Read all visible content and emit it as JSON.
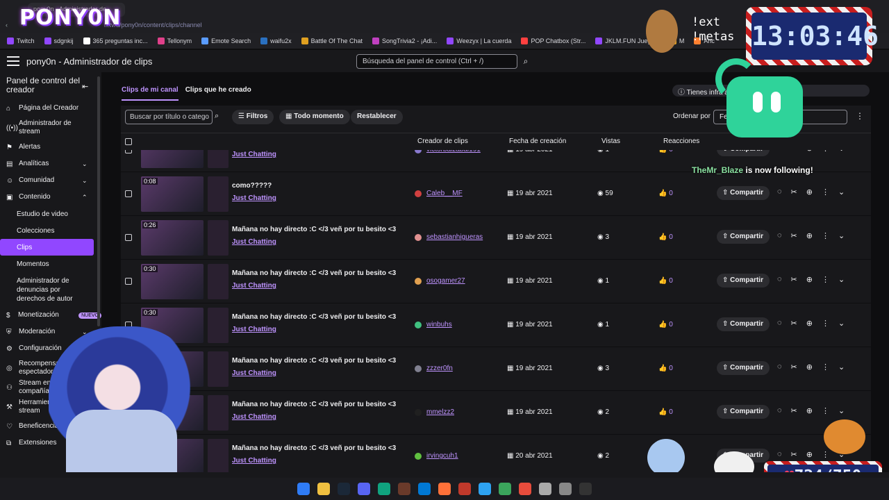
{
  "browser": {
    "tab_title": "pony0n - Administrador de",
    "url": "h.tv/u/pony0n/content/clips/channel"
  },
  "bookmarks": [
    {
      "label": "Twitch",
      "color": "#9147ff"
    },
    {
      "label": "sdgnkij",
      "color": "#9147ff"
    },
    {
      "label": "365 preguntas inc...",
      "color": "#ffffff"
    },
    {
      "label": "Tellonym",
      "color": "#e0408a"
    },
    {
      "label": "Emote Search",
      "color": "#5a9cff"
    },
    {
      "label": "waifu2x",
      "color": "#2a70c0"
    },
    {
      "label": "Battle Of The Chat",
      "color": "#e0a020"
    },
    {
      "label": "SongTrivia2 - ¡Adi...",
      "color": "#c040c0"
    },
    {
      "label": "Weezyx | La cuerda",
      "color": "#9147ff"
    },
    {
      "label": "POP Chatbox (Str...",
      "color": "#ff4040"
    },
    {
      "label": "JKLM.FUN Juego...",
      "color": "#9147ff"
    },
    {
      "label": "M",
      "color": "#e0a020"
    },
    {
      "label": "Anc",
      "color": "#ff8030"
    }
  ],
  "overlay": {
    "logo": "PONY0N",
    "clock": "13:03:46",
    "commands": [
      "!ext",
      "!metas"
    ],
    "follow_name": "TheMr_Blaze",
    "follow_text": " is now following!",
    "goal": "724/750"
  },
  "topbar": {
    "title": "pony0n - Administrador de clips",
    "search_placeholder": "Búsqueda del panel de control (Ctrl + /)"
  },
  "sidebar": {
    "header": "Panel de control del creador",
    "items": [
      {
        "label": "Página del Creador",
        "icon": "⌂"
      },
      {
        "label": "Administrador de stream",
        "icon": "((•))"
      },
      {
        "label": "Alertas",
        "icon": "⚑"
      },
      {
        "label": "Analíticas",
        "icon": "▤",
        "chevron": "⌄"
      },
      {
        "label": "Comunidad",
        "icon": "☺",
        "chevron": "⌄"
      },
      {
        "label": "Contenido",
        "icon": "▣",
        "chevron": "⌃"
      }
    ],
    "sub_items": [
      "Estudio de video",
      "Colecciones",
      "Clips",
      "Momentos",
      "Administrador de denuncias por derechos de autor"
    ],
    "items_after": [
      {
        "label": "Monetización",
        "icon": "$",
        "badge": "NUEVO"
      },
      {
        "label": "Moderación",
        "icon": "⛨",
        "chevron": "⌄"
      },
      {
        "label": "Configuración",
        "icon": "⚙"
      },
      {
        "label": "Recompensas del espectador",
        "icon": "◎"
      },
      {
        "label": "Stream en compañía",
        "icon": "⚇"
      },
      {
        "label": "Herramientas de stream",
        "icon": "⚒"
      },
      {
        "label": "Beneficencia",
        "icon": "♡"
      },
      {
        "label": "Extensiones",
        "icon": "⧉"
      }
    ]
  },
  "tabs": [
    "Clips de mi canal",
    "Clips que he creado"
  ],
  "info_pill": "Tienes infra                                autor en tu canal",
  "toolbar": {
    "filter_placeholder": "Buscar por título o catego",
    "filters": "Filtros",
    "time": "Todo momento",
    "reset": "Restablecer",
    "sort_label": "Ordenar por",
    "sort_value": "Fec                    s primero)"
  },
  "columns": {
    "creator": "Creador de clips",
    "date": "Fecha de creación",
    "views": "Vistas",
    "reactions": "Reacciones"
  },
  "rows": [
    {
      "duration": "",
      "title": "",
      "game": "Just Chatting",
      "creator": "victorbalzabal191",
      "date": "19 abr 2021",
      "views": "1",
      "reactions": "0",
      "share": "Compartir",
      "avatar_color": "#8a7ad0"
    },
    {
      "duration": "0:08",
      "title": "como?????",
      "game": "Just Chatting",
      "creator": "Caleb__MF",
      "date": "19 abr 2021",
      "views": "59",
      "reactions": "0",
      "share": "Compartir",
      "avatar_color": "#d04040"
    },
    {
      "duration": "0:26",
      "title": "Mañana no hay directo :C </3 veñ por tu besito <3",
      "game": "Just Chatting",
      "creator": "sebastianhigueras",
      "date": "19 abr 2021",
      "views": "3",
      "reactions": "0",
      "share": "Compartir",
      "avatar_color": "#e09090"
    },
    {
      "duration": "0:30",
      "title": "Mañana no hay directo :C </3 veñ por tu besito <3",
      "game": "Just Chatting",
      "creator": "osogamer27",
      "date": "19 abr 2021",
      "views": "1",
      "reactions": "0",
      "share": "Compartir",
      "avatar_color": "#e0a050"
    },
    {
      "duration": "0:30",
      "title": "Mañana no hay directo :C </3 veñ por tu besito <3",
      "game": "Just Chatting",
      "creator": "winbuhs",
      "date": "19 abr 2021",
      "views": "1",
      "reactions": "0",
      "share": "Compartir",
      "avatar_color": "#40c080"
    },
    {
      "duration": "0:30",
      "title": "Mañana no hay directo :C </3 veñ por tu besito <3",
      "game": "Just Chatting",
      "creator": "zzzer0fn",
      "date": "19 abr 2021",
      "views": "3",
      "reactions": "0",
      "share": "Compartir",
      "avatar_color": "#808090"
    },
    {
      "duration": "",
      "title": "Mañana no hay directo :C </3 veñ por tu besito <3",
      "game": "Just Chatting",
      "creator": "mmelzz2",
      "date": "19 abr 2021",
      "views": "2",
      "reactions": "0",
      "share": "Compartir",
      "avatar_color": "#202020"
    },
    {
      "duration": "0:",
      "title": "Mañana no hay directo :C </3 veñ por tu besito <3",
      "game": "Just Chatting",
      "creator": "irvingcuh1",
      "date": "20 abr 2021",
      "views": "2",
      "reactions": "0",
      "share": "Compartir",
      "avatar_color": "#60c040"
    }
  ],
  "icons": {
    "calendar": "▦",
    "eye": "◉",
    "thumb": "👍",
    "share": "⇧",
    "loading": "◌",
    "scissors": "✂",
    "download": "⊕",
    "more": "⋮",
    "expand": "⌄"
  }
}
